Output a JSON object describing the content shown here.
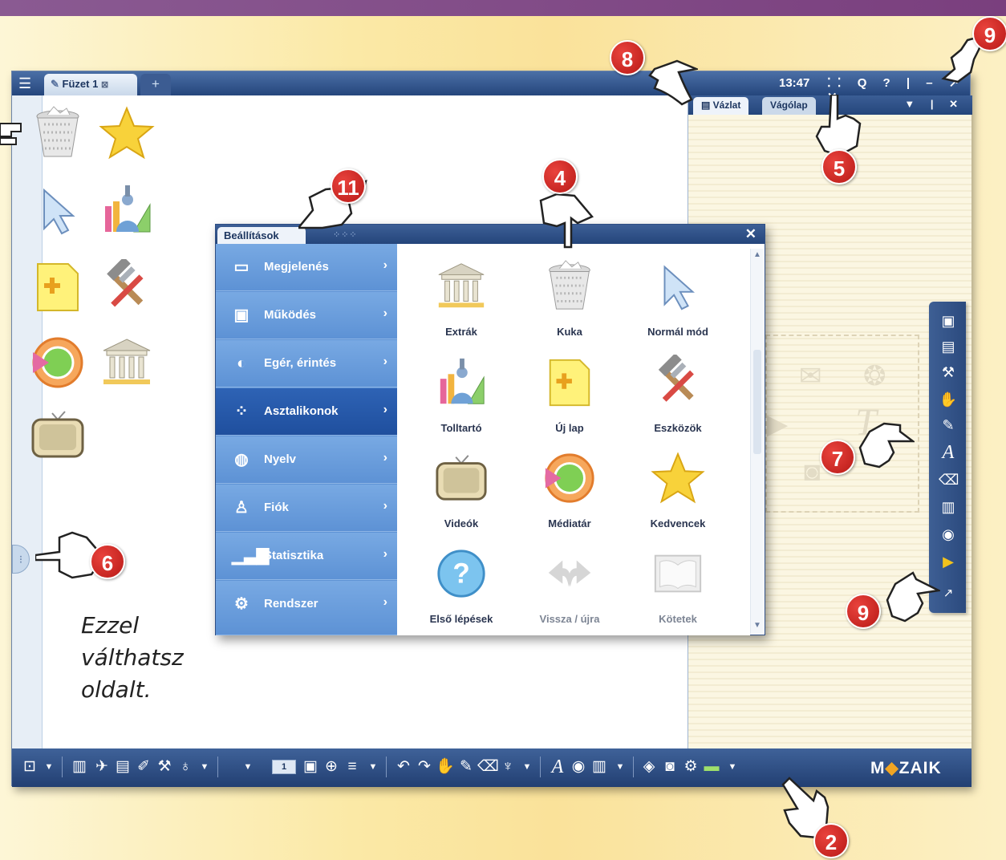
{
  "window": {
    "tab_title": "Füzet 1",
    "tab_close": "⊠",
    "add_tab": "+",
    "clock": "13:47",
    "controls": "⁚⁚ Q ? | – ↗ ✕"
  },
  "right_panel": {
    "tabs": [
      "Vázlat",
      "Vágólap"
    ],
    "controls": "▼ | ✕"
  },
  "desktop_icons": [
    "trash-icon",
    "star-icon",
    "pointer-icon",
    "pencil-case-icon",
    "new-page-icon",
    "tools-icon",
    "media-library-icon",
    "extras-icon",
    "tv-icon"
  ],
  "dialog": {
    "title": "Beállítások",
    "close": "✕",
    "nav": [
      {
        "label": "Megjelenés",
        "icon": "monitor-icon"
      },
      {
        "label": "Működés",
        "icon": "window-icon"
      },
      {
        "label": "Egér, érintés",
        "icon": "mouse-icon"
      },
      {
        "label": "Asztalikonok",
        "icon": "dots-icon",
        "active": true
      },
      {
        "label": "Nyelv",
        "icon": "globe-icon"
      },
      {
        "label": "Fiók",
        "icon": "user-icon"
      },
      {
        "label": "Statisztika",
        "icon": "bar-chart-icon"
      },
      {
        "label": "Rendszer",
        "icon": "system-icon"
      }
    ],
    "tiles": [
      {
        "label": "Extrák",
        "icon": "extras-icon"
      },
      {
        "label": "Kuka",
        "icon": "trash-icon"
      },
      {
        "label": "Normál mód",
        "icon": "pointer-icon"
      },
      {
        "label": "Tolltartó",
        "icon": "pencil-case-icon"
      },
      {
        "label": "Új lap",
        "icon": "new-page-icon"
      },
      {
        "label": "Eszközök",
        "icon": "tools-icon"
      },
      {
        "label": "Videók",
        "icon": "tv-icon"
      },
      {
        "label": "Médiatár",
        "icon": "media-library-icon"
      },
      {
        "label": "Kedvencek",
        "icon": "star-icon"
      },
      {
        "label": "Első lépések",
        "icon": "help-icon"
      },
      {
        "label": "Vissza / újra",
        "icon": "undo-redo-icon"
      },
      {
        "label": "Kötetek",
        "icon": "book-icon"
      }
    ]
  },
  "bottom_toolbar": {
    "page_number": "1",
    "brand": "MOZAIK"
  },
  "callouts": [
    "8",
    "9",
    "11",
    "4",
    "5",
    "7",
    "6",
    "9",
    "2"
  ],
  "note_text": "Ezzel válthatsz oldalt."
}
